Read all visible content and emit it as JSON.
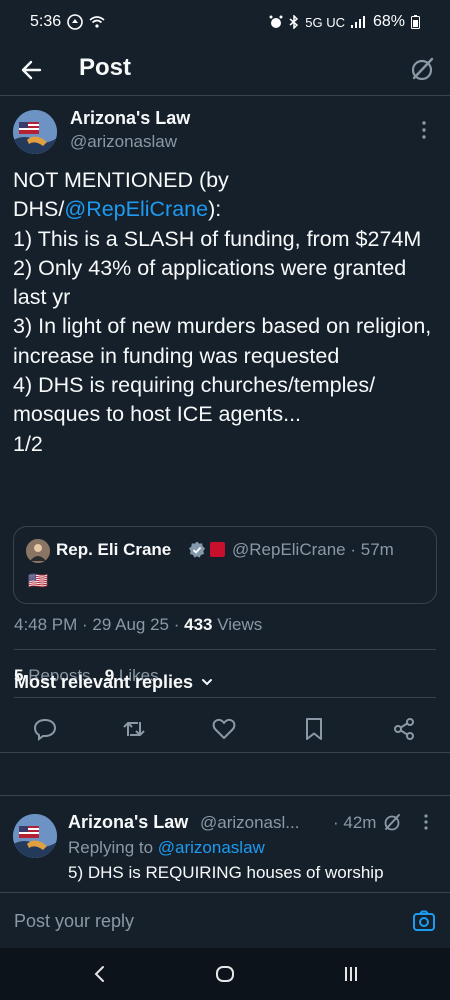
{
  "status": {
    "time": "5:36",
    "network": "5G UC",
    "battery": "68%"
  },
  "header": {
    "title": "Post"
  },
  "post": {
    "author_name": "Arizona's Law",
    "author_handle": "@arizonaslaw",
    "text_before": "NOT MENTIONED (by\nDHS/",
    "mention": "@RepEliCrane",
    "text_after": "):\n1) This is a SLASH of funding, from $274M\n2) Only 43% of applications were granted last yr\n3) In light of new murders based on religion, increase in funding was requested\n4) DHS is requiring churches/temples/ mosques to host ICE agents...\n1/2",
    "quote": {
      "author_name": "Rep. Eli Crane",
      "author_handle": "@RepEliCrane · 57m",
      "text": "🇺🇸"
    },
    "meta": {
      "time_date": "4:48 PM · 29 Aug 25 · ",
      "views_count": "433",
      "views_label": " Views"
    },
    "stats": {
      "reposts_count": "5",
      "reposts_label": " Reposts",
      "likes_count": "9",
      "likes_label": " Likes"
    }
  },
  "replies": {
    "heading": "Most relevant replies",
    "items": [
      {
        "author_name": "Arizona's Law",
        "author_handle": "@arizonasl...",
        "time": "· 42m",
        "replying_prefix": "Replying to ",
        "replying_to": "@arizonaslaw",
        "text": "5) DHS is REQUIRING houses of worship"
      }
    ]
  },
  "composer": {
    "placeholder": "Post your reply"
  },
  "colors": {
    "background": "#15202b",
    "accent": "#1d9bf0",
    "muted": "#8b98a5",
    "border": "#38444d"
  }
}
